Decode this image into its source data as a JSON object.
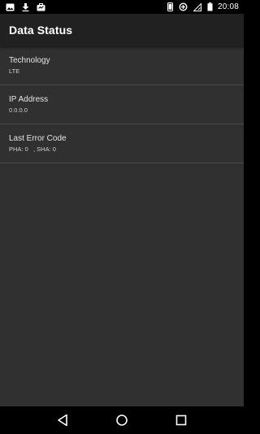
{
  "status_bar": {
    "left_icons": [
      "image-icon",
      "download-icon",
      "briefcase-icon"
    ],
    "right_icons": [
      "phone-icon",
      "data-saver-icon",
      "signal-icon",
      "battery-icon"
    ],
    "time": "20:08"
  },
  "app_bar": {
    "title": "Data Status"
  },
  "items": [
    {
      "title": "Technology",
      "summary": "LTE"
    },
    {
      "title": "IP Address",
      "summary": "0.0.0.0"
    },
    {
      "title": "Last Error Code",
      "summary": "PHA: 0   , SHA: 0"
    }
  ],
  "nav_bar": {
    "buttons": [
      "back-icon",
      "home-icon",
      "recents-icon"
    ]
  },
  "colors": {
    "background": "#303030",
    "app_bar": "#212121",
    "status_bar": "#000000",
    "divider": "#4a4a4a",
    "text_primary": "#e6e6e6"
  }
}
